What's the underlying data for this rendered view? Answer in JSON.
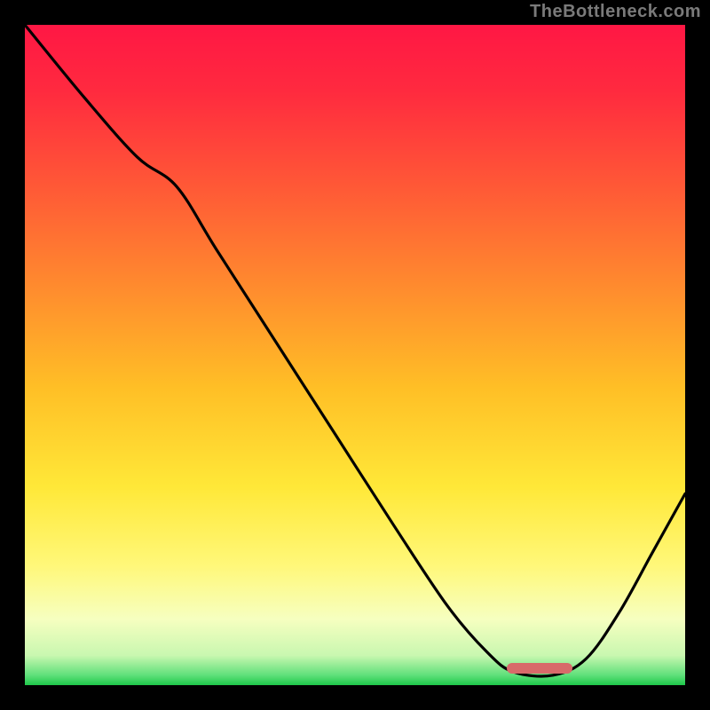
{
  "watermark": "TheBottleneck.com",
  "colors": {
    "frame_bg": "#000000",
    "curve_stroke": "#000000",
    "sweet_spot_fill": "#d86a6a"
  },
  "gradient_stops": [
    {
      "offset": 0.0,
      "color": "#ff1744"
    },
    {
      "offset": 0.1,
      "color": "#ff2a3f"
    },
    {
      "offset": 0.25,
      "color": "#ff5a36"
    },
    {
      "offset": 0.4,
      "color": "#ff8c2e"
    },
    {
      "offset": 0.55,
      "color": "#ffbf26"
    },
    {
      "offset": 0.7,
      "color": "#ffe838"
    },
    {
      "offset": 0.82,
      "color": "#fff87a"
    },
    {
      "offset": 0.9,
      "color": "#f6ffc0"
    },
    {
      "offset": 0.955,
      "color": "#c9f7b0"
    },
    {
      "offset": 0.985,
      "color": "#5fe07a"
    },
    {
      "offset": 1.0,
      "color": "#1ec74a"
    }
  ],
  "sweet_spot": {
    "x_start": 0.73,
    "x_end": 0.83,
    "y": 0.975
  },
  "chart_data": {
    "type": "line",
    "title": "",
    "xlabel": "",
    "ylabel": "",
    "xlim": [
      0,
      1
    ],
    "ylim": [
      0,
      1
    ],
    "note": "Bottleneck-style curve. x is normalized horizontal position (0=left, 1=right). y is normalized value 0..1 where 1=top (worst / high bottleneck) and 0=bottom (best / no bottleneck). The curve descends from top-left, flattens near x≈0.73–0.83 at the bottom (sweet spot), then rises again toward the right edge. Values are read off the rendered curve; the image has no numeric axis labels so units are relative.",
    "series": [
      {
        "name": "bottleneck-curve",
        "points": [
          {
            "x": 0.0,
            "y": 1.0
          },
          {
            "x": 0.09,
            "y": 0.89
          },
          {
            "x": 0.17,
            "y": 0.8
          },
          {
            "x": 0.23,
            "y": 0.755
          },
          {
            "x": 0.29,
            "y": 0.66
          },
          {
            "x": 0.38,
            "y": 0.52
          },
          {
            "x": 0.47,
            "y": 0.38
          },
          {
            "x": 0.56,
            "y": 0.24
          },
          {
            "x": 0.64,
            "y": 0.12
          },
          {
            "x": 0.7,
            "y": 0.05
          },
          {
            "x": 0.74,
            "y": 0.02
          },
          {
            "x": 0.8,
            "y": 0.015
          },
          {
            "x": 0.85,
            "y": 0.04
          },
          {
            "x": 0.9,
            "y": 0.11
          },
          {
            "x": 0.95,
            "y": 0.2
          },
          {
            "x": 1.0,
            "y": 0.29
          }
        ]
      }
    ]
  }
}
